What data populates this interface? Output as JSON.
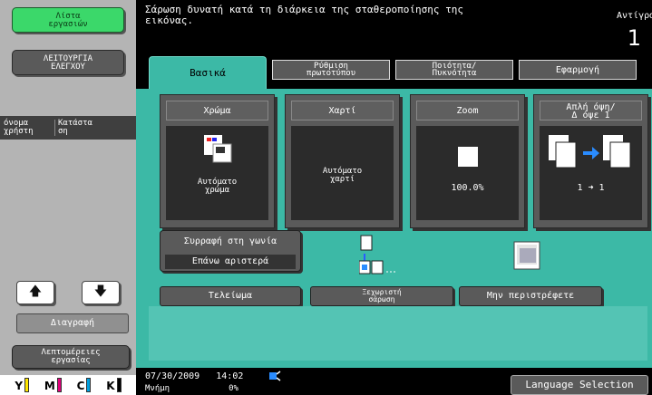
{
  "sidebar": {
    "job_list": "Λίστα\nεργασιών",
    "check_job": "ΛΕΙΤΟΥΡΓΙΑ\nΕΛΕΓΧΟΥ",
    "col_user": "όνομα\nχρήστη",
    "col_status": "Κατάστα\nση",
    "delete": "Διαγραφή",
    "job_details": "Λεπτομέρειες\nεργασίας",
    "toner": [
      {
        "letter": "Y",
        "color": "#ffe600"
      },
      {
        "letter": "M",
        "color": "#e0007a"
      },
      {
        "letter": "C",
        "color": "#00a0e0"
      },
      {
        "letter": "K",
        "color": "#000000"
      }
    ]
  },
  "header": {
    "message": "Σάρωση δυνατή κατά τη διάρκεια της σταθεροποίησης της εικόνας.",
    "copies_label": "Αντίγραφα:",
    "copies_value": "1"
  },
  "tabs": {
    "basic": "Βασικά",
    "original_settings": "Ρύθμιση\nπρωτοτύπου",
    "quality_density": "Ποιότητα/\nΠυκνότητα",
    "application": "Εφαρμογή"
  },
  "cards": {
    "color": {
      "title": "Χρώμα",
      "value": "Αυτόματο\nχρώμα"
    },
    "paper": {
      "title": "Χαρτί",
      "value": "Αυτόματο\nχαρτί"
    },
    "zoom": {
      "title": "Zoom",
      "value": "100.0%"
    },
    "duplex": {
      "title": "Απλή όψη/\nΔ όψε 1",
      "value": "1 ➜ 1"
    }
  },
  "finishing": {
    "corner_staple": "Συρραφή στη γωνία",
    "corner_position": "Επάνω αριστερά",
    "finishing_btn": "Τελείωμα",
    "separate_scan": "Ξεχωριστή\nσάρωση",
    "no_rotate": "Μην περιστρέφετε"
  },
  "footer": {
    "datetime": "07/30/2009   14:02",
    "memory": "Μνήμη            0%",
    "language": "Language Selection"
  }
}
